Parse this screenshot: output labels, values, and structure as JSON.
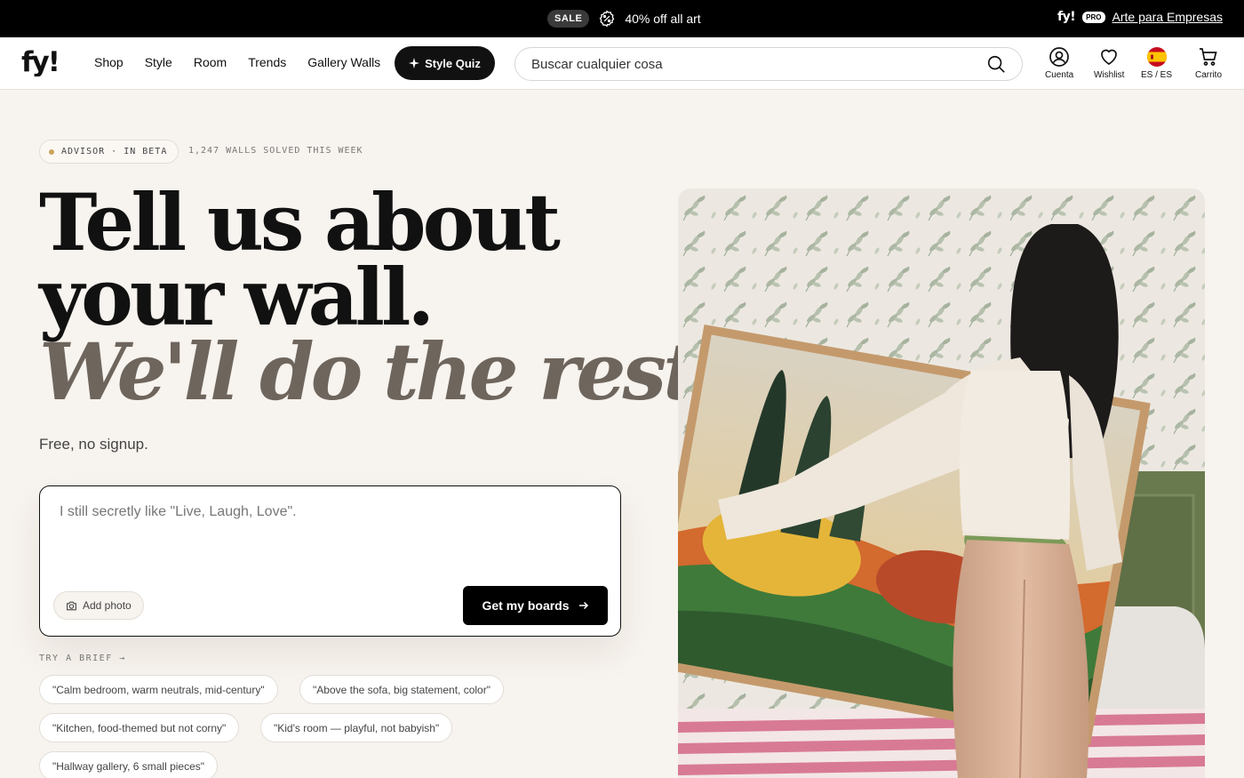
{
  "promo": {
    "sale_badge": "SALE",
    "offer_text": "40% off all art",
    "pro_brand": "fy!",
    "pro_badge": "PRO",
    "business_link": "Arte para Empresas"
  },
  "header": {
    "logo": "fy!",
    "nav": [
      "Shop",
      "Style",
      "Room",
      "Trends",
      "Gallery Walls"
    ],
    "quiz_button": "Style Quiz",
    "search_placeholder": "Buscar cualquier cosa",
    "account_label": "Cuenta",
    "wishlist_label": "Wishlist",
    "locale_label": "ES / ES",
    "cart_label": "Carrito"
  },
  "hero": {
    "beta_label": "ADVISOR · IN BETA",
    "walls_count": "1,247 WALLS SOLVED THIS WEEK",
    "headline_line1": "Tell us about",
    "headline_line2": "your wall.",
    "headline_line3": "We'll do the rest.",
    "subtitle": "Free, no signup.",
    "brief_placeholder": "I still secretly like \"Live, Laugh, Love\".",
    "add_photo": "Add photo",
    "submit": "Get my boards",
    "try_label": "TRY A BRIEF →",
    "briefs": [
      "\"Calm bedroom, warm neutrals, mid-century\"",
      "\"Above the sofa, big statement, color\"",
      "\"Kitchen, food-themed but not corny\"",
      "\"Kid's room — playful, not babyish\"",
      "\"Hallway gallery, 6 small pieces\""
    ]
  },
  "colors": {
    "background": "#f7f3ee",
    "accent_dark": "#111111",
    "italic_gray": "#6e655d",
    "beta_dot": "#c9a45c"
  }
}
